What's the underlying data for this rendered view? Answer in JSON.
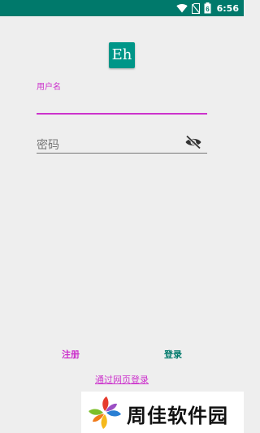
{
  "status_bar": {
    "time": "6:56",
    "battery_level": "6",
    "icons": [
      "wifi-icon",
      "no-sim-icon",
      "battery-icon"
    ],
    "background": "#00796b"
  },
  "app": {
    "logo_text": "Eh",
    "logo_color": "#009688"
  },
  "form": {
    "username": {
      "label": "用户名",
      "value": ""
    },
    "password": {
      "placeholder": "密码",
      "value": "",
      "toggle_icon": "visibility-off-icon"
    }
  },
  "actions": {
    "register_label": "注册",
    "login_label": "登录",
    "web_login_label": "通过网页登录"
  },
  "colors": {
    "accent": "#cc33cc",
    "primary": "#00796b"
  },
  "watermark": {
    "text": "周佳软件园"
  }
}
